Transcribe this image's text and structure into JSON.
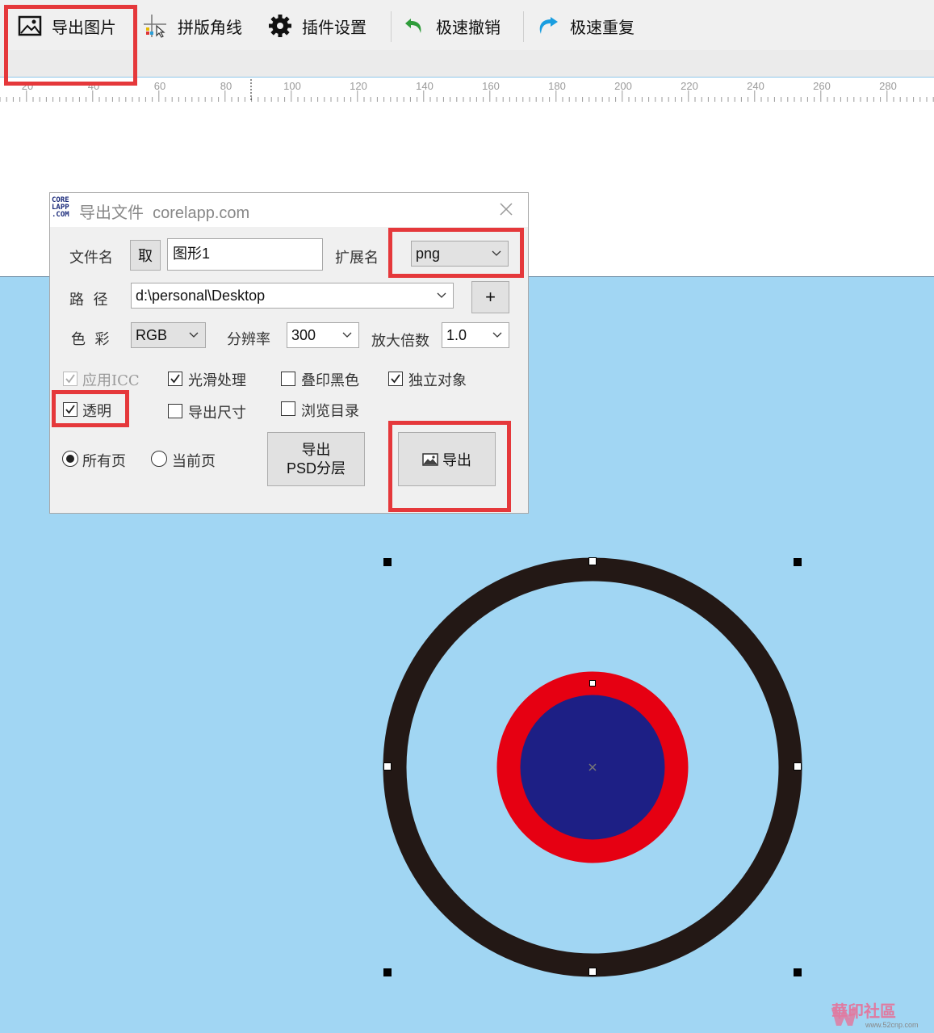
{
  "toolbar": {
    "export_image": "导出图片",
    "crop_marks": "拼版角线",
    "plugin_settings": "插件设置",
    "fast_undo": "极速撤销",
    "fast_redo": "极速重复"
  },
  "ruler": {
    "ticks": [
      "20",
      "40",
      "60",
      "80",
      "100",
      "120",
      "140",
      "160",
      "180",
      "200",
      "220",
      "240",
      "260",
      "280"
    ]
  },
  "dialog": {
    "logo": [
      "CORE",
      "LAPP",
      ".COM"
    ],
    "title": "导出文件  corelapp.com",
    "filename_label": "文件名",
    "take_button": "取",
    "filename_value": "图形1",
    "extension_label": "扩展名",
    "extension_value": "png",
    "path_label": "路  径",
    "path_value": "d:\\personal\\Desktop",
    "add_button": "+",
    "color_label": "色  彩",
    "color_value": "RGB",
    "resolution_label": "分辨率",
    "resolution_value": "300",
    "scale_label": "放大倍数",
    "scale_value": "1.0",
    "apply_icc": "应用ICC",
    "smooth": "光滑处理",
    "overprint_black": "叠印黑色",
    "independent_object": "独立对象",
    "transparent": "透明",
    "export_size": "导出尺寸",
    "browse_dir": "浏览目录",
    "all_pages": "所有页",
    "current_page": "当前页",
    "psd_button_line1": "导出",
    "psd_button_line2": "PSD分层",
    "export_button": "导出"
  },
  "colors": {
    "canvas_blue": "#a1d6f3",
    "ring_black": "#231815",
    "ring_red": "#e60012",
    "core_blue": "#1d1f85",
    "highlight": "#e5383b"
  },
  "watermark": {
    "text": "華印社區",
    "url": "www.52cnp.com"
  }
}
